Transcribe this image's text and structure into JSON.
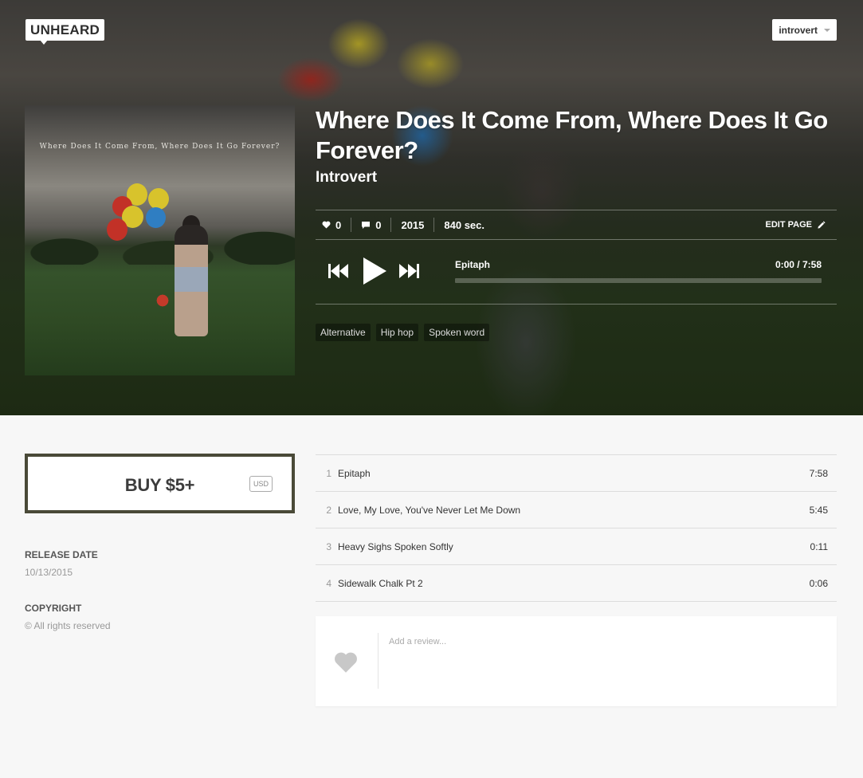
{
  "app": {
    "logo": "UNHEARD"
  },
  "header": {
    "user_menu_label": "introvert"
  },
  "album": {
    "cover_text": "Where Does It Come From, Where Does It Go Forever?",
    "title": "Where Does It Come From, Where Does It Go Forever?",
    "artist": "Introvert",
    "likes": "0",
    "comments": "0",
    "year": "2015",
    "duration": "840 sec.",
    "edit_label": "EDIT PAGE"
  },
  "player": {
    "current_track": "Epitaph",
    "time": "0:00 / 7:58",
    "progress": 0
  },
  "tags": [
    "Alternative",
    "Hip hop",
    "Spoken word"
  ],
  "buy": {
    "label": "BUY $5+",
    "currency": "USD"
  },
  "meta": {
    "release_date_label": "RELEASE DATE",
    "release_date": "10/13/2015",
    "copyright_label": "COPYRIGHT",
    "copyright": "© All rights reserved"
  },
  "tracks": [
    {
      "num": "1",
      "title": "Epitaph",
      "duration": "7:58"
    },
    {
      "num": "2",
      "title": "Love, My Love, You've Never Let Me Down",
      "duration": "5:45"
    },
    {
      "num": "3",
      "title": "Heavy Sighs Spoken Softly",
      "duration": "0:11"
    },
    {
      "num": "4",
      "title": "Sidewalk Chalk Pt 2",
      "duration": "0:06"
    }
  ],
  "review": {
    "placeholder": "Add a review..."
  },
  "icons": {
    "like": "heart-icon",
    "comment": "comment-icon",
    "edit": "pencil-icon",
    "prev": "skip-back-icon",
    "play": "play-icon",
    "next": "skip-forward-icon",
    "review": "heart-icon"
  }
}
